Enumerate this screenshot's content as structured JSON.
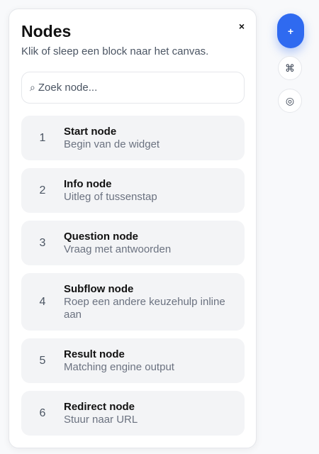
{
  "panel": {
    "title": "Nodes",
    "subtitle": "Klik of sleep een block naar het canvas.",
    "close_icon": "×"
  },
  "search": {
    "icon": "⌕",
    "placeholder": "Zoek node...",
    "value": ""
  },
  "nodes": [
    {
      "number": "1",
      "title": "Start node",
      "description": "Begin van de widget"
    },
    {
      "number": "2",
      "title": "Info node",
      "description": "Uitleg of tussenstap"
    },
    {
      "number": "3",
      "title": "Question node",
      "description": "Vraag met antwoorden"
    },
    {
      "number": "4",
      "title": "Subflow node",
      "description": "Roep een andere keuzehulp inline aan"
    },
    {
      "number": "5",
      "title": "Result node",
      "description": "Matching engine output"
    },
    {
      "number": "6",
      "title": "Redirect node",
      "description": "Stuur naar URL"
    }
  ],
  "rail": {
    "add_icon": "+",
    "command_icon": "⌘",
    "target_icon": "◎"
  },
  "colors": {
    "accent": "#2f6af0",
    "panel_bg": "#ffffff",
    "item_bg": "#f3f4f6",
    "page_bg": "#f8f9fb"
  }
}
